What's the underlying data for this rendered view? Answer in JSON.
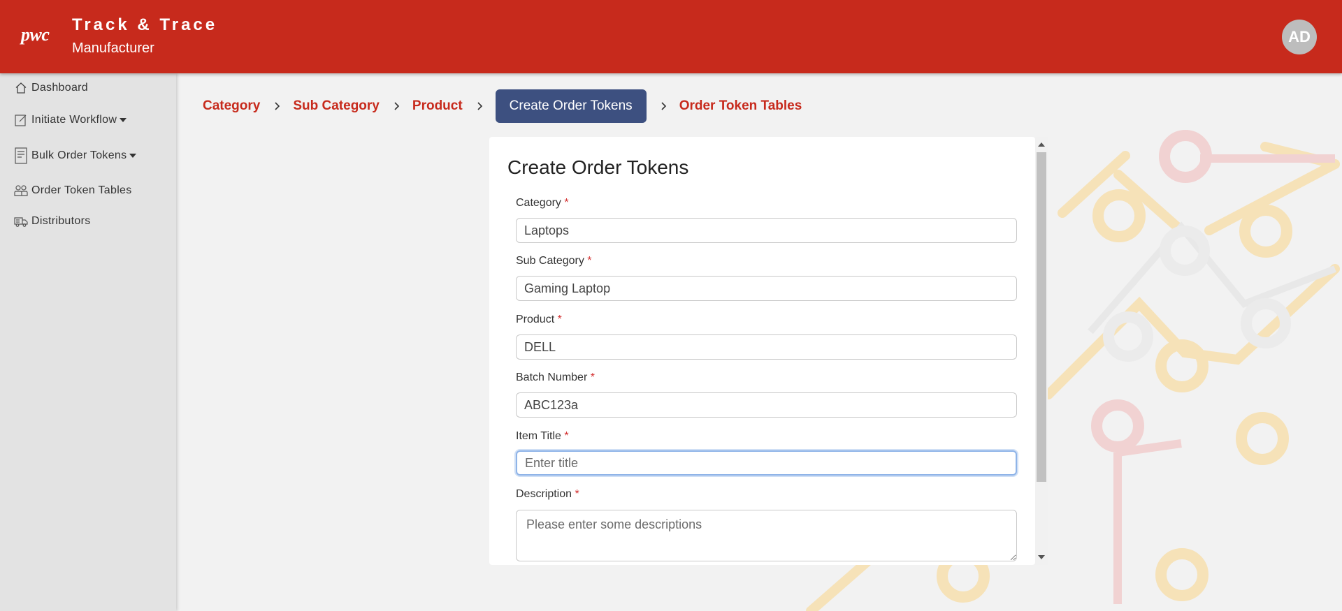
{
  "header": {
    "logo": "pwc",
    "title": "Track & Trace",
    "subtitle": "Manufacturer",
    "avatar_initials": "AD",
    "color": "#c72a1c"
  },
  "sidebar": {
    "items": [
      {
        "label": "Dashboard",
        "icon": "home-icon"
      },
      {
        "label": "Initiate Workflow",
        "icon": "edit-icon",
        "dropdown": true
      },
      {
        "label": "Bulk Order Tokens",
        "icon": "document-icon",
        "dropdown": true
      },
      {
        "label": "Order Token Tables",
        "icon": "users-icon"
      },
      {
        "label": "Distributors",
        "icon": "truck-icon"
      }
    ]
  },
  "breadcrumb": {
    "items": [
      "Category",
      "Sub Category",
      "Product",
      "Create Order Tokens",
      "Order Token Tables"
    ],
    "active": "Create Order Tokens",
    "active_color": "#3d5080"
  },
  "form": {
    "title": "Create Order Tokens",
    "fields": [
      {
        "label": "Category",
        "value": "Laptops",
        "required": "*"
      },
      {
        "label": "Sub Category",
        "value": "Gaming Laptop",
        "required": "*"
      },
      {
        "label": "Product",
        "value": "DELL",
        "required": "*"
      },
      {
        "label": "Batch Number",
        "value": "ABC123a",
        "required": "*"
      },
      {
        "label": "Item Title",
        "value": "",
        "placeholder": "Enter title",
        "required": "*"
      },
      {
        "label": "Description",
        "value": "",
        "placeholder": "Please enter some descriptions",
        "required": "*"
      }
    ]
  }
}
